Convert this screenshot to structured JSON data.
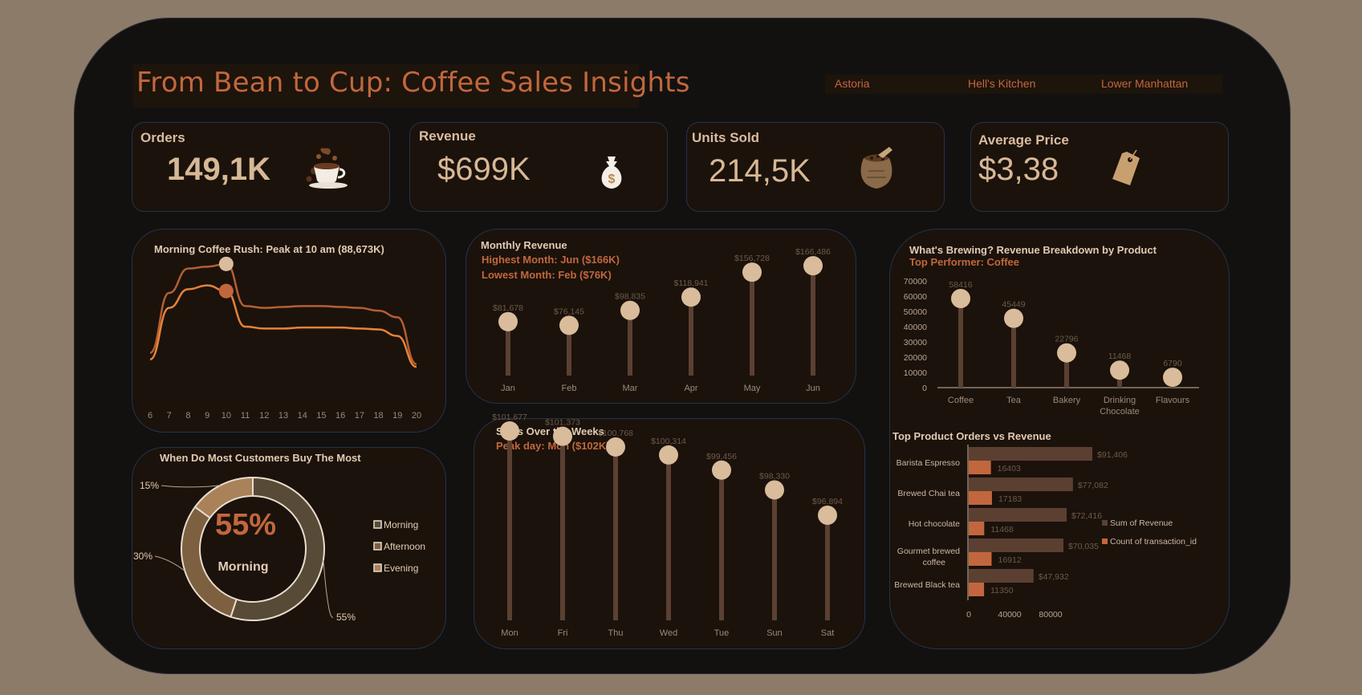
{
  "header": {
    "title": "From Bean to Cup: Coffee Sales Insights",
    "slicers": [
      "Astoria",
      "Hell's Kitchen",
      "Lower Manhattan"
    ]
  },
  "kpis": {
    "orders": {
      "label": "Orders",
      "value": "149,1K",
      "icon": "coffee-cup-icon"
    },
    "revenue": {
      "label": "Revenue",
      "value": "$699K",
      "icon": "money-bag-icon"
    },
    "units": {
      "label": "Units Sold",
      "value": "214,5K",
      "icon": "coffee-sack-icon"
    },
    "price": {
      "label": "Average Price",
      "value": "$3,38",
      "icon": "price-tag-icon"
    }
  },
  "colors": {
    "accent": "#c2673d",
    "bubble": "#d9bc9b",
    "stem": "#5b4032",
    "background": "#121110",
    "panel": "#1b120b"
  },
  "chart_data": [
    {
      "id": "hourly",
      "type": "line",
      "title": "Morning Coffee Rush: Peak at 10 am (88,673K)",
      "x": [
        6,
        7,
        8,
        9,
        10,
        11,
        12,
        13,
        14,
        15,
        16,
        17,
        18,
        19,
        20
      ],
      "series": [
        {
          "values": [
            2.0,
            8.4,
            11.0,
            11.2,
            11.5,
            7.0,
            6.8,
            6.9,
            7.0,
            7.0,
            6.9,
            6.8,
            6.5,
            5.8,
            0.8
          ]
        },
        {
          "values": [
            1.3,
            6.8,
            8.8,
            9.2,
            8.6,
            4.8,
            4.6,
            4.6,
            4.7,
            4.7,
            4.7,
            4.6,
            4.5,
            3.8,
            0.5
          ]
        }
      ],
      "highlight_x": 10,
      "grid": false
    },
    {
      "id": "monthly",
      "type": "lollipop",
      "title": "Monthly Revenue",
      "subtitles": [
        "Highest Month: Jun ($166K)",
        "Lowest Month: Feb ($76K)"
      ],
      "categories": [
        "Jan",
        "Feb",
        "Mar",
        "Apr",
        "May",
        "Jun"
      ],
      "values": [
        81678,
        76145,
        98835,
        118941,
        156728,
        166486
      ],
      "labels": [
        "$81,678",
        "$76,145",
        "$98,835",
        "$118,941",
        "$156,728",
        "$166,486"
      ],
      "ylim": [
        0,
        180000
      ]
    },
    {
      "id": "timeofday",
      "type": "pie",
      "title": "When Do Most Customers Buy The Most",
      "center_value": "55%",
      "center_label": "Morning",
      "slices": [
        {
          "name": "Morning",
          "value": 55,
          "label": "55%",
          "color": "#574a37"
        },
        {
          "name": "Afternoon",
          "value": 30,
          "label": "30%",
          "color": "#7d6040"
        },
        {
          "name": "Evening",
          "value": 15,
          "label": "15%",
          "color": "#a98259"
        }
      ],
      "legend": [
        "Morning",
        "Afternoon",
        "Evening"
      ],
      "legend_position": "right"
    },
    {
      "id": "weekday",
      "type": "lollipop",
      "title": "Sales Over the Weeks",
      "subtitles": [
        "Peak day: Mon ($102K)"
      ],
      "categories": [
        "Mon",
        "Fri",
        "Thu",
        "Wed",
        "Tue",
        "Sun",
        "Sat"
      ],
      "values": [
        101677,
        101373,
        100768,
        100314,
        99456,
        98330,
        96894
      ],
      "labels": [
        "$101,677",
        "$101,373",
        "$100,768",
        "$100,314",
        "$99,456",
        "$98,330",
        "$96,894"
      ],
      "ylim": [
        95000,
        102000
      ]
    },
    {
      "id": "product",
      "type": "lollipop",
      "title": "What's Brewing? Revenue Breakdown by Product",
      "subtitles": [
        "Top Performer: Coffee"
      ],
      "categories": [
        "Coffee",
        "Tea",
        "Bakery",
        "Drinking Chocolate",
        "Flavours"
      ],
      "values": [
        58416,
        45449,
        22796,
        11468,
        6790
      ],
      "labels": [
        "58416",
        "45449",
        "22796",
        "11468",
        "6790"
      ],
      "yticks": [
        0,
        10000,
        20000,
        30000,
        40000,
        50000,
        60000,
        70000
      ],
      "ylim": [
        0,
        70000
      ]
    },
    {
      "id": "topproducts",
      "type": "bar",
      "orientation": "horizontal",
      "title": "Top Product  Orders vs Revenue",
      "categories": [
        "Barista Espresso",
        "Brewed Chai tea",
        "Hot chocolate",
        "Gourmet brewed coffee",
        "Brewed Black tea"
      ],
      "series": [
        {
          "name": "Sum of Revenue",
          "values": [
            91406,
            77082,
            72416,
            70035,
            47932
          ],
          "labels": [
            "$91,406",
            "$77,082",
            "$72,416",
            "$70,035",
            "$47,932"
          ],
          "color": "#5b4032"
        },
        {
          "name": "Count of transaction_id",
          "values": [
            16403,
            17183,
            11468,
            16912,
            11350
          ],
          "labels": [
            "16403",
            "17183",
            "11468",
            "16912",
            "11350"
          ],
          "color": "#c2673d"
        }
      ],
      "xticks": [
        "0",
        "40000",
        "80000"
      ],
      "xlim": [
        0,
        120000
      ],
      "legend_position": "right"
    }
  ]
}
